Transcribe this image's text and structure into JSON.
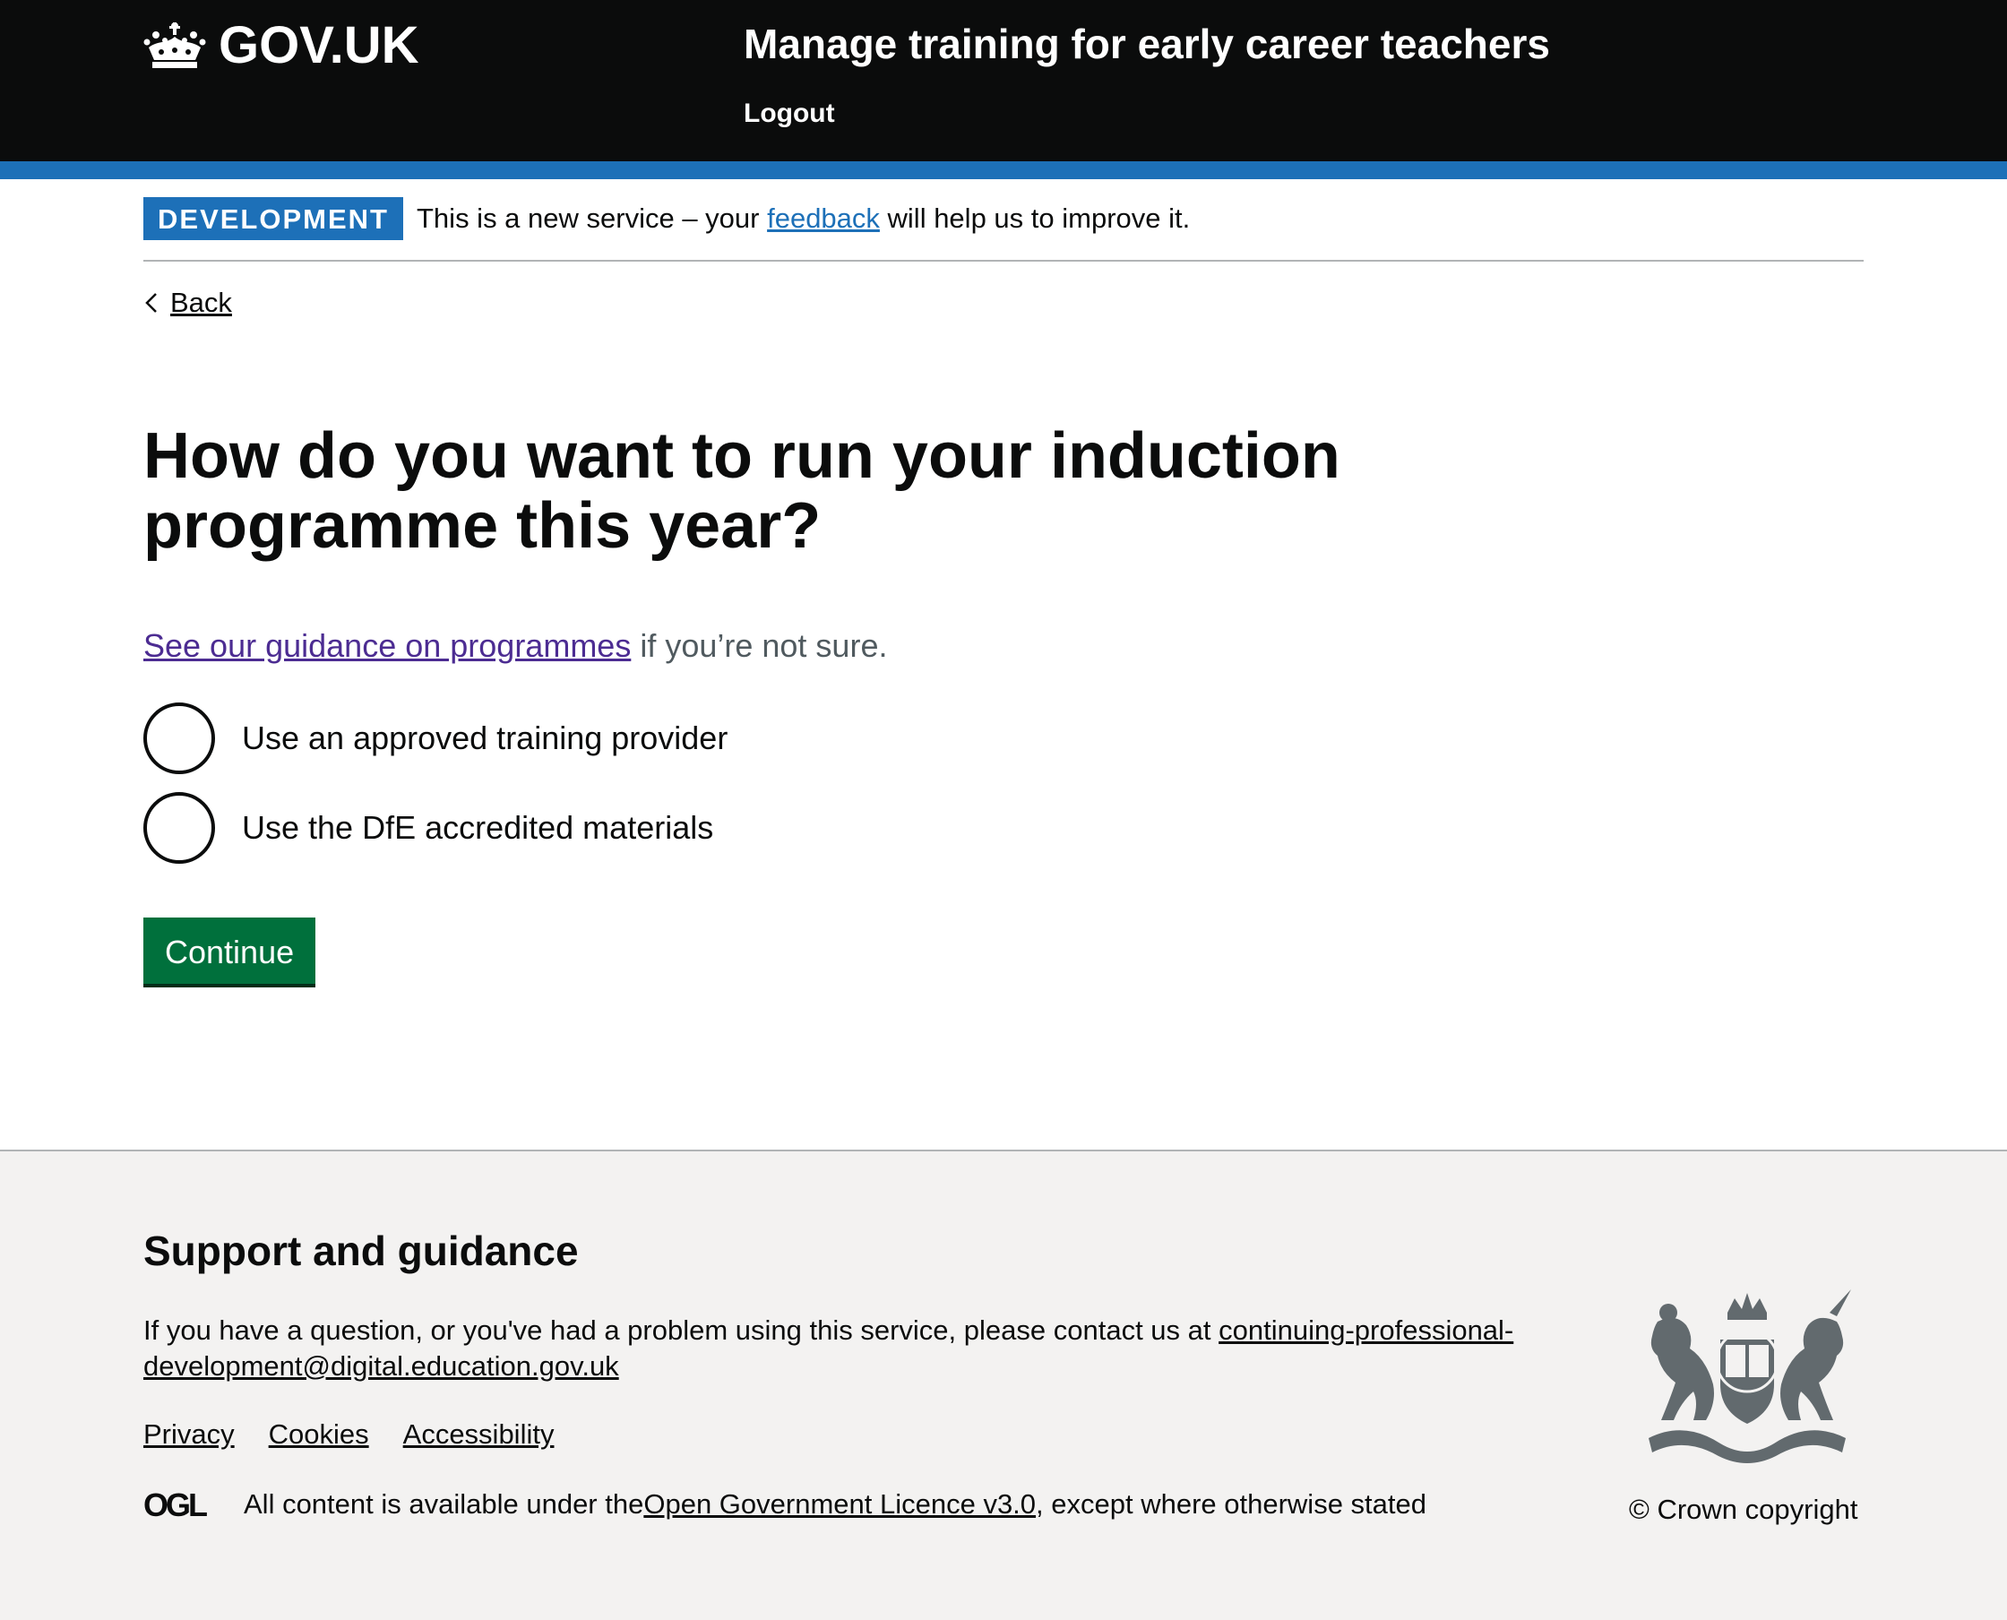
{
  "header": {
    "logo_text": "GOV.UK",
    "service_name": "Manage training for early career teachers",
    "logout": "Logout"
  },
  "phase_banner": {
    "tag": "DEVELOPMENT",
    "text_before": "This is a new service – your ",
    "link": "feedback",
    "text_after": " will help us to improve it."
  },
  "back": "Back",
  "main": {
    "heading": "How do you want to run your induction programme this year?",
    "hint_link": "See our guidance on programmes",
    "hint_text": " if you’re not sure.",
    "options": [
      {
        "label": "Use an approved training provider",
        "selected": false
      },
      {
        "label": "Use the DfE accredited materials",
        "selected": false
      }
    ],
    "continue": "Continue"
  },
  "footer": {
    "title": "Support and guidance",
    "contact_text": "If you have a question, or you've had a problem using this service, please contact us at ",
    "contact_email": "continuing-professional-development@digital.education.gov.uk",
    "links": [
      "Privacy",
      "Cookies",
      "Accessibility"
    ],
    "licence_before": "All content is available under the ",
    "licence_link": "Open Government Licence v3.0",
    "licence_after": ", except where otherwise stated",
    "copyright": "© Crown copyright",
    "ogl_logo": "OGL"
  },
  "colors": {
    "header": "#0b0c0c",
    "brand_blue": "#1d70b8",
    "button": "#00703c",
    "visited_link": "#4c2c92",
    "footer_bg": "#f3f2f1"
  },
  "icons": [
    "crown-icon",
    "chevron-left-icon",
    "ogl-logo",
    "royal-coat-of-arms"
  ]
}
